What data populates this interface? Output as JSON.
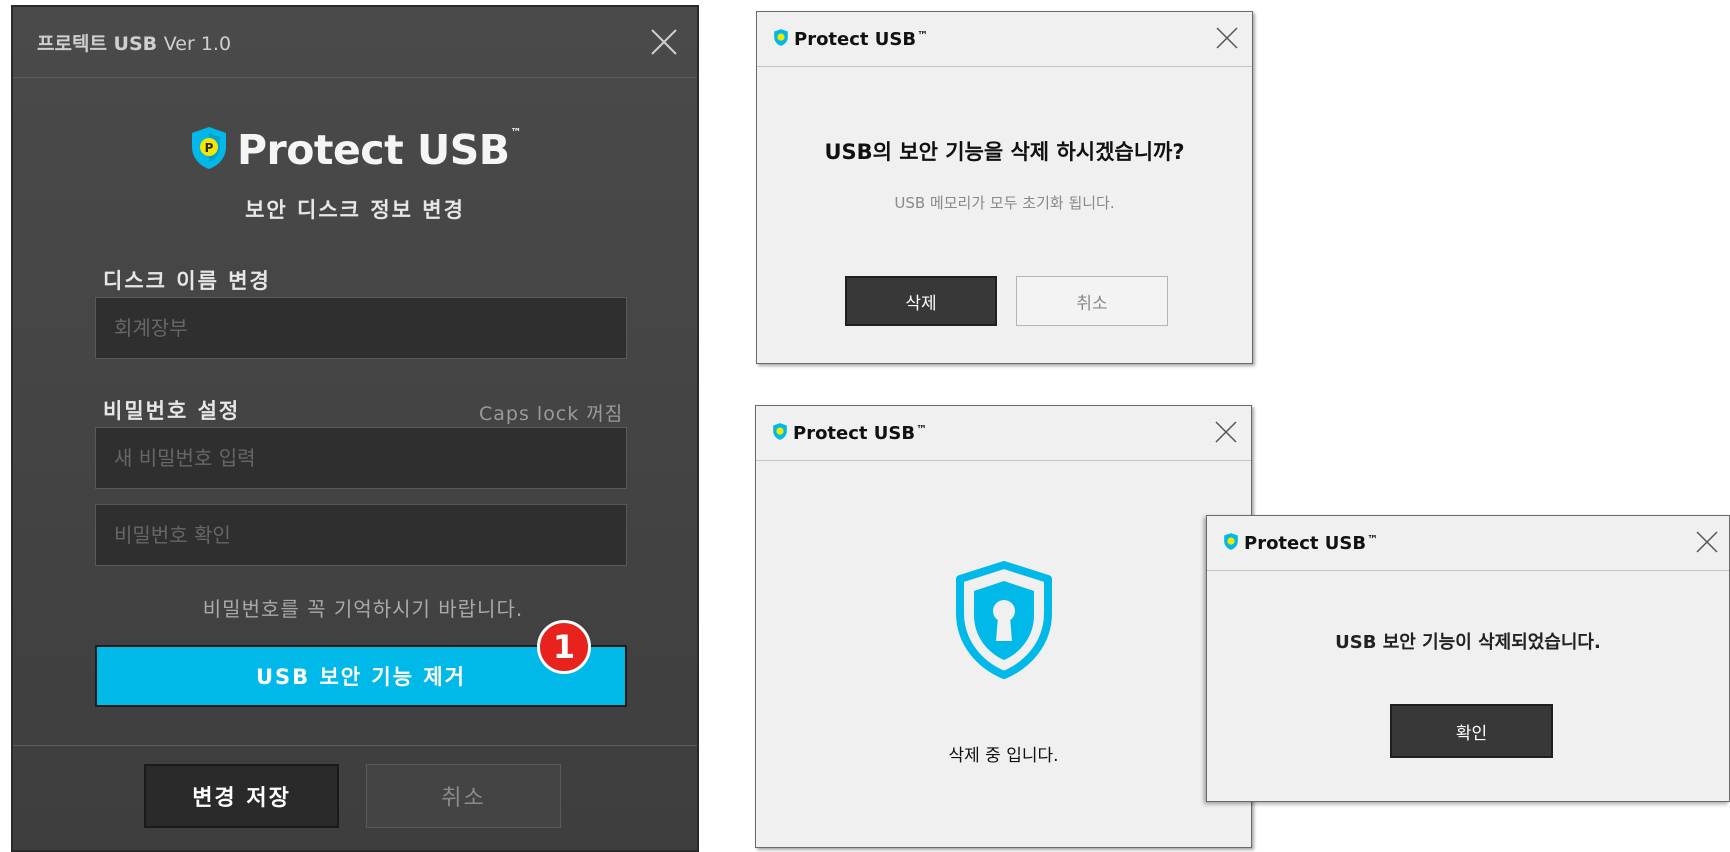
{
  "main_window": {
    "title": "프로텍트 USB",
    "version": "Ver 1.0",
    "brand": "Protect USB",
    "trademark": "™",
    "subtitle": "보안 디스크 정보 변경",
    "disk_name_label": "디스크 이름 변경",
    "disk_name_placeholder": "회계장부",
    "password_label": "비밀번호 설정",
    "capslock_status": "Caps lock 꺼짐",
    "new_password_placeholder": "새 비밀번호 입력",
    "confirm_password_placeholder": "비밀번호 확인",
    "password_hint": "비밀번호를 꼭 기억하시기 바랍니다.",
    "remove_security_label": "USB 보안 기능 제거",
    "step_badge": "1",
    "save_label": "변경 저장",
    "cancel_label": "취소"
  },
  "confirm_dialog": {
    "brand": "Protect USB",
    "trademark": "™",
    "question": "USB의 보안 기능을 삭제 하시겠습니까?",
    "warning": "USB 메모리가 모두 초기화 됩니다.",
    "delete_label": "삭제",
    "cancel_label": "취소"
  },
  "progress_dialog": {
    "brand": "Protect USB",
    "trademark": "™",
    "status": "삭제 중 입니다."
  },
  "done_dialog": {
    "brand": "Protect USB",
    "trademark": "™",
    "message": "USB 보안 기능이 삭제되었습니다.",
    "ok_label": "확인"
  },
  "colors": {
    "accent": "#00b9e8",
    "badge": "#e8231e",
    "dark_bg": "#444444",
    "dialog_bg": "#f0f0f0"
  },
  "icons": [
    "shield-logo-icon",
    "close-icon",
    "shield-keyhole-icon"
  ]
}
